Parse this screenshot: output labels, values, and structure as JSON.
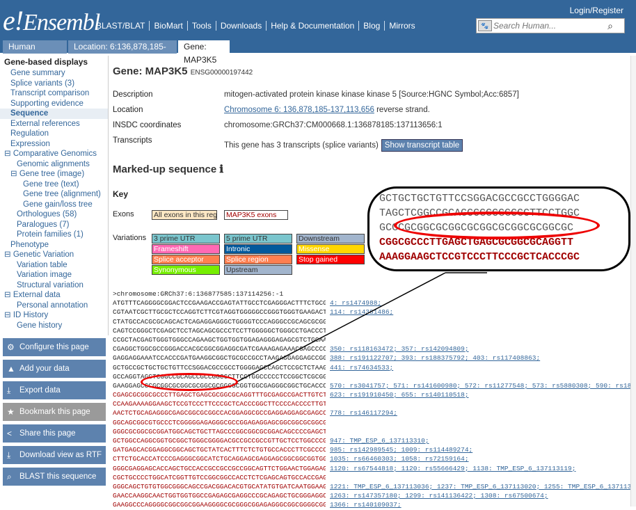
{
  "header": {
    "logo_e": "e!",
    "logo_text": "Ensembl",
    "login": "Login/Register",
    "nav": [
      "BLAST/BLAT",
      "BioMart",
      "Tools",
      "Downloads",
      "Help & Documentation",
      "Blog",
      "Mirrors"
    ],
    "search_placeholder": "Search Human..."
  },
  "tabs": [
    {
      "label": "Human (GRCh37) ▼"
    },
    {
      "label": "Location: 6:136,878,185-137,113,656"
    },
    {
      "label": "Gene: MAP3K5"
    }
  ],
  "sidebar": {
    "heading": "Gene-based displays",
    "items": [
      {
        "label": "Gene summary",
        "indent": 1
      },
      {
        "label": "Splice variants (3)",
        "indent": 1
      },
      {
        "label": "Transcript comparison",
        "indent": 1
      },
      {
        "label": "Supporting evidence",
        "indent": 1
      },
      {
        "label": "Sequence",
        "indent": 1,
        "current": true
      },
      {
        "label": "External references",
        "indent": 1
      },
      {
        "label": "Regulation",
        "indent": 1
      },
      {
        "label": "Expression",
        "indent": 1
      },
      {
        "label": "⊟ Comparative Genomics",
        "indent": 0
      },
      {
        "label": "Genomic alignments",
        "indent": 2
      },
      {
        "label": "⊟ Gene tree (image)",
        "indent": 1
      },
      {
        "label": "Gene tree (text)",
        "indent": 3
      },
      {
        "label": "Gene tree (alignment)",
        "indent": 3
      },
      {
        "label": "Gene gain/loss tree",
        "indent": 3
      },
      {
        "label": "Orthologues (58)",
        "indent": 2
      },
      {
        "label": "Paralogues (7)",
        "indent": 2
      },
      {
        "label": "Protein families (1)",
        "indent": 2
      },
      {
        "label": "Phenotype",
        "indent": 1
      },
      {
        "label": "⊟ Genetic Variation",
        "indent": 0
      },
      {
        "label": "Variation table",
        "indent": 2
      },
      {
        "label": "Variation image",
        "indent": 2
      },
      {
        "label": "Structural variation",
        "indent": 2
      },
      {
        "label": "⊟ External data",
        "indent": 0
      },
      {
        "label": "Personal annotation",
        "indent": 2
      },
      {
        "label": "⊟ ID History",
        "indent": 0
      },
      {
        "label": "Gene history",
        "indent": 2
      }
    ],
    "buttons": [
      {
        "icon": "⚙",
        "label": "Configure this page",
        "disabled": false
      },
      {
        "icon": "▲",
        "label": "Add your data",
        "disabled": false
      },
      {
        "icon": "⤓",
        "label": "Export data",
        "disabled": false
      },
      {
        "icon": "★",
        "label": "Bookmark this page",
        "disabled": true
      },
      {
        "icon": "<",
        "label": "Share this page",
        "disabled": false
      },
      {
        "icon": "⤓",
        "label": "Download view as RTF",
        "disabled": false
      },
      {
        "icon": "⌕",
        "label": "BLAST this sequence",
        "disabled": false
      }
    ]
  },
  "gene": {
    "title": "Gene: MAP3K5",
    "id": "ENSG00000197442",
    "description_label": "Description",
    "description": "mitogen-activated protein kinase kinase kinase 5 [Source:HGNC Symbol;Acc:6857]",
    "location_label": "Location",
    "location_link": "Chromosome 6: 136,878,185-137,113,656",
    "location_suffix": "reverse strand.",
    "insdc_label": "INSDC coordinates",
    "insdc": "chromosome:GRCh37:CM000668.1:136878185:137113656:1",
    "transcripts_label": "Transcripts",
    "transcripts_text": "This gene has 3 transcripts (splice variants)",
    "transcripts_button": "Show transcript table"
  },
  "markup": {
    "heading": "Marked-up sequence",
    "info_icon": "ℹ",
    "key_label": "Key",
    "exons_label": "Exons",
    "variations_label": "Variations",
    "exons": [
      {
        "label": "All exons in this region",
        "bg": "#fde8c4",
        "fg": "#333"
      },
      {
        "label": "MAP3K5 exons",
        "bg": "#ffffff",
        "fg": "#a00000"
      }
    ],
    "variations": [
      {
        "label": "3 prime UTR",
        "bg": "#7ac5cd",
        "fg": "#333"
      },
      {
        "label": "5 prime UTR",
        "bg": "#7ac5cd",
        "fg": "#333"
      },
      {
        "label": "Downstream",
        "bg": "#a2b5cd",
        "fg": "#333"
      },
      {
        "label": "Frameshift",
        "bg": "#ff69b4",
        "fg": "#fff"
      },
      {
        "label": "Intronic",
        "bg": "#02599c",
        "fg": "#fff"
      },
      {
        "label": "Missense",
        "bg": "#ffd700",
        "fg": "#fff"
      },
      {
        "label": "Splice acceptor",
        "bg": "#ff7f50",
        "fg": "#fff"
      },
      {
        "label": "Splice region",
        "bg": "#ff7f50",
        "fg": "#fff"
      },
      {
        "label": "Stop gained",
        "bg": "#ff0000",
        "fg": "#fff"
      },
      {
        "label": "Synonymous",
        "bg": "#76ee00",
        "fg": "#fff"
      },
      {
        "label": "Upstream",
        "bg": "#a2b5cd",
        "fg": "#333"
      }
    ]
  },
  "zoom": {
    "lines": [
      {
        "text": "GCTGCTGCTGTTCCSGGACGCCGCCTGGGGAC",
        "color": "#555"
      },
      {
        "text": "TAGCTCGGCCGCAGCCGCCGGCGCTTCCTGGC",
        "color": "#555"
      },
      {
        "text": "GCGCGCGGCGCGGCGCGGCGCGGCGCGGCGC",
        "color": "#555"
      },
      {
        "text": "CGGCGCCCTTGAGCTGAGCGCGGCGCAGGTT",
        "color": "#a00000"
      },
      {
        "text": "AAAGGAAGCTCCGTCCCTTCCCGCTCACCCGC",
        "color": "#a00000"
      }
    ]
  },
  "sequence": {
    "header": ">chromosome:GRCh37:6:136877585:137114256:-1",
    "lines": [
      {
        "s": "ATGTTTCAGGGGCGGACTCCGAAGACCGAGTATTGCCTCGAGGGACTTTCTGCGCCACCC",
        "v": "4: rs1474988;",
        "red": false
      },
      {
        "s": "CGTAATCGCTTGCGCTCCAGGTCTTCGTAGGTGGGGGCCGGGTGGGTGAAGACTGGGACC",
        "v": "114: rs14381486;",
        "red": false
      },
      {
        "s": "CTATGCCACGCGCAGCACTCAGAGGAGGGCTGGGGTCCCAGGGCCGCAGCGCGGTCAGTT",
        "v": "",
        "red": false
      },
      {
        "s": "CAGTCCGGGCTCGAGCTCCTAGCAGCGCCCTCCTTGGGGGCTGGGCCTGACCCTCGGTG",
        "v": "",
        "red": false
      },
      {
        "s": "CCGCTACGAGTGGGTGGGCCAGAAGCTGGTGGTGGAGAGGGAGAGCGTCTGCAAGGACGC",
        "v": "",
        "red": false
      },
      {
        "s": "CGAGGCTGGCGCCGGGACCACGCGGCGGAGGCGATCGAAAGAGAAACGAGCCCCGCCAAG",
        "v": "350: rs118163472; 357: rs142094809;",
        "red": false
      },
      {
        "s": "GAGGAGGAAATCCACCCGATGAAGGCGGCTGCGCCGCCTAAGAGGAGGAGCCGGCCCTTTG",
        "v": "388: rs191122707; 393: rs188375792; 403: rs117408863;",
        "red": false
      },
      {
        "s": "GCTGCCGCTGCTGCTGTTCCSGGACGCCGCCTGGGGAGCCAGCTCCGCTCTAAGGTGCGC",
        "v": "441: rs74634533;",
        "red": false
      },
      {
        "s": "GCCAGGTAGCTCGGCCGCAGCCGCCGGCGCTTCCTGGCCCCCTCCGGCTCGCGGGACG",
        "v": "",
        "red": false
      },
      {
        "s": "GAAGGAGCGCGCGGCGCGGCGCGGCGCGGCGCGGTGGCGAGGGCGGCTGCACCC",
        "v": "570: rs3041757; 571: rs141600980; 572: rs11277548; 573: rs5880308; 590: rs183320694;",
        "red": false
      },
      {
        "s": "CGAGCGCGGCGCCCTTGAGCTGAGCGCGGCGCAGGTTTGCGAGCCGACTTGTCTGCCGG",
        "v": "623: rs191910450; 655: rs140110518;",
        "red": true
      },
      {
        "s": "CCAAGAAAAGGAAGCTCCGTCCCTTCCCGCTCACCCGGCTTCCCCACCCCTTGTACTCTA",
        "v": "",
        "red": true
      },
      {
        "s": "AACTCTGCAGAGGGCGAGCGGCGCGGCCACGGAGGCGCCGAGGAGGAGCGAGCCGCCTCC",
        "v": "778: rs146117294;",
        "red": true
      },
      {
        "s": "GGCAGCGGCGTGCCCTCGGGGGAGAGGGCGCCGGAGAGGAGCGGCGGCGCGGCGGCGA",
        "v": "",
        "red": true
      },
      {
        "s": "GGGCGCGGCGCGGATGGCAGCTGCTTAGCCCGGCGGCGCGGACAGCCCCGAGCTGTG",
        "v": "",
        "red": true
      },
      {
        "s": "GCTGGCCAGGCGGTGCGGCTGGGCGGGGACGCCGCCGCCGTTGCTCCTGGCCCGGAGA",
        "v": "947: TMP_ESP_6_137113310;",
        "red": true
      },
      {
        "s": "GATGAGCACGGAGGCGGCAGCTGCTATCACTTTCTCTGTGCCACCCTTCGCCCCTCGGG",
        "v": "985: rs142989545; 1009: rs114489274;",
        "red": true
      },
      {
        "s": "CTTCTGCACCATCCCGAGGGCGGCATCTGCAGGAGCGAGGAGCGGCGGCGGTGGGCGA",
        "v": "1035: rs66460303; 1058: rs72159164;",
        "red": true
      },
      {
        "s": "GGGCGAGGAGCACCAGCTGCCACCGCCGCCGCCGGCAGTTCTGGAACTGGAGAGTCGC",
        "v": "1120: rs67544818; 1120: rs55666429; 1138: TMP_ESP_6_137113119;",
        "red": true
      },
      {
        "s": "CGCTGCCCCTGGCATCGGTTGTCCGGCGGCCACCTCTCGAGCAGTGCCACCGAGGCCG",
        "v": "",
        "red": true
      },
      {
        "s": "GGGCAGCTGTGTGGCGGGCAGCCGACGGACACGTGCATATGTGATCAATGGAAGAATTT",
        "v": "1221: TMP_ESP_6_137113036; 1237: TMP_ESP_6_137113020; 1255: TMP_ESP_6_137113002;",
        "red": true
      },
      {
        "s": "GAACCAAGGCAACTGGTGGTGGCCGAGAGCGAGGCCCGCAGAGCTGCGGGAGGCGTG",
        "v": "1263: rs147357180; 1299: rs141136422; 1308: rs67500674;",
        "red": true
      },
      {
        "s": "GAAGGCCCAGGGGCGGCGGCGGAAGGGGCGCGGGCGGAGAGGGCGGCGGGGCGGCGG",
        "v": "1366: rs140109037;",
        "red": true
      }
    ]
  }
}
